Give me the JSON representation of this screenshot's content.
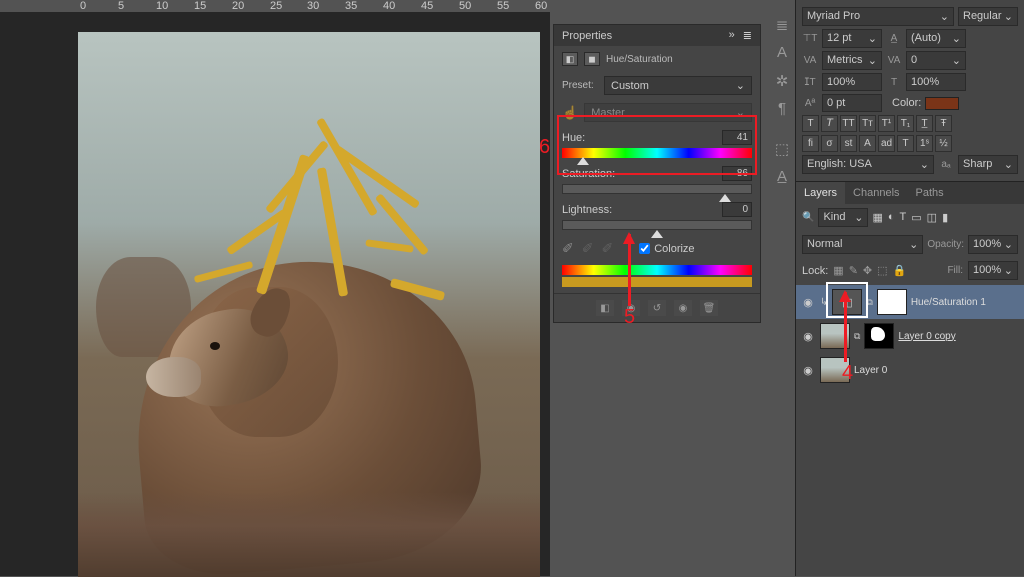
{
  "ruler_marks": [
    "0",
    "5",
    "10",
    "15",
    "20",
    "25",
    "30",
    "35",
    "40",
    "45",
    "50",
    "55",
    "60"
  ],
  "properties": {
    "title": "Properties",
    "adjustment": "Hue/Saturation",
    "preset_label": "Preset:",
    "preset_value": "Custom",
    "channel": "Master",
    "hue": {
      "label": "Hue:",
      "value": "41",
      "pos": 11
    },
    "saturation": {
      "label": "Saturation:",
      "value": "86",
      "pos": 86
    },
    "lightness": {
      "label": "Lightness:",
      "value": "0",
      "pos": 50
    },
    "colorize_label": "Colorize",
    "colorize_checked": true
  },
  "annotations": {
    "n4": "4",
    "n5": "5",
    "n6": "6"
  },
  "character": {
    "font_family": "Myriad Pro",
    "font_style": "Regular",
    "font_size": "12 pt",
    "leading": "(Auto)",
    "kerning": "Metrics",
    "tracking": "0",
    "vscale": "100%",
    "hscale": "100%",
    "baseline": "0 pt",
    "color_label": "Color:",
    "lang": "English: USA",
    "aa": "Sharp"
  },
  "layers": {
    "tab_layers": "Layers",
    "tab_channels": "Channels",
    "tab_paths": "Paths",
    "kind": "Kind",
    "blend": "Normal",
    "opacity_label": "Opacity:",
    "opacity": "100%",
    "lock_label": "Lock:",
    "fill_label": "Fill:",
    "fill": "100%",
    "items": [
      {
        "name": "Hue/Saturation 1"
      },
      {
        "name": "Layer 0 copy"
      },
      {
        "name": "Layer 0"
      }
    ]
  }
}
